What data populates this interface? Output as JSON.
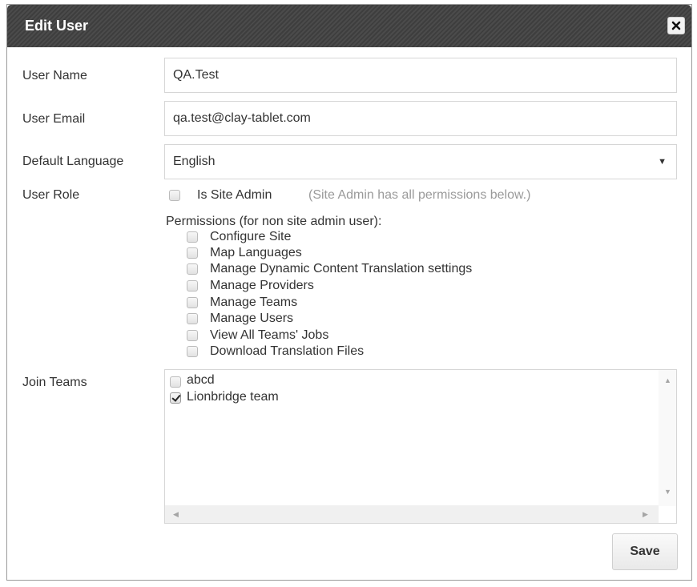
{
  "dialog": {
    "title": "Edit User"
  },
  "form": {
    "user_name_label": "User Name",
    "user_name_value": "QA.Test",
    "user_email_label": "User Email",
    "user_email_value": "qa.test@clay-tablet.com",
    "default_language_label": "Default Language",
    "default_language_value": "English",
    "user_role_label": "User Role",
    "is_site_admin_label": "Is Site Admin",
    "site_admin_note": "(Site Admin has all permissions below.)",
    "permissions_heading": "Permissions (for non site admin user):",
    "permissions": [
      {
        "label": "Configure Site",
        "checked": false
      },
      {
        "label": "Map Languages",
        "checked": false
      },
      {
        "label": "Manage Dynamic Content Translation settings",
        "checked": false
      },
      {
        "label": "Manage Providers",
        "checked": false
      },
      {
        "label": "Manage Teams",
        "checked": false
      },
      {
        "label": "Manage Users",
        "checked": false
      },
      {
        "label": "View All Teams' Jobs",
        "checked": false
      },
      {
        "label": "Download Translation Files",
        "checked": false
      }
    ],
    "join_teams_label": "Join Teams",
    "teams": [
      {
        "label": "abcd",
        "checked": false
      },
      {
        "label": "Lionbridge team",
        "checked": true
      }
    ]
  },
  "actions": {
    "save_label": "Save"
  },
  "icons": {
    "close": "close-icon",
    "dropdown": "chevron-down-icon"
  }
}
